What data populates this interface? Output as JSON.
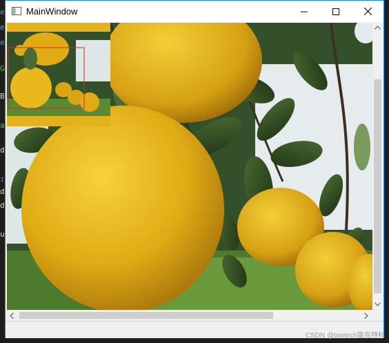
{
  "window": {
    "title": "MainWindow",
    "controls": [
      "minimize",
      "maximize",
      "close"
    ]
  },
  "image": {
    "subject": "pomelos",
    "overview_thumbnail": true,
    "selection_rect_color": "#d22b2b"
  },
  "scrollbars": {
    "vertical": {
      "position": 0.13,
      "visible_fraction": 0.78
    },
    "horizontal": {
      "position": 0.0,
      "visible_fraction": 0.74
    }
  },
  "watermark": "CSDN @txwtech笛克特科",
  "colors": {
    "titlebar_border": "#1883d7",
    "fruit": "#e3b21c",
    "leaf": "#2f4a22",
    "sky": "#e8eef0"
  }
}
